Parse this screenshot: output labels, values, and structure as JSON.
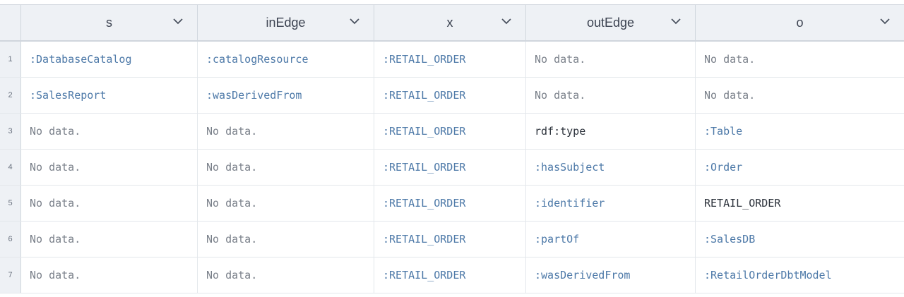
{
  "columns": [
    "s",
    "inEdge",
    "x",
    "outEdge",
    "o"
  ],
  "rows": [
    {
      "num": "1",
      "s": ":DatabaseCatalog",
      "inEdge": ":catalogResource",
      "x": ":RETAIL_ORDER",
      "outEdge": "No data.",
      "o": "No data."
    },
    {
      "num": "2",
      "s": ":SalesReport",
      "inEdge": ":wasDerivedFrom",
      "x": ":RETAIL_ORDER",
      "outEdge": "No data.",
      "o": "No data."
    },
    {
      "num": "3",
      "s": "No data.",
      "inEdge": "No data.",
      "x": ":RETAIL_ORDER",
      "outEdge": "rdf:type",
      "o": ":Table"
    },
    {
      "num": "4",
      "s": "No data.",
      "inEdge": "No data.",
      "x": ":RETAIL_ORDER",
      "outEdge": ":hasSubject",
      "o": ":Order"
    },
    {
      "num": "5",
      "s": "No data.",
      "inEdge": "No data.",
      "x": ":RETAIL_ORDER",
      "outEdge": ":identifier",
      "o": "RETAIL_ORDER"
    },
    {
      "num": "6",
      "s": "No data.",
      "inEdge": "No data.",
      "x": ":RETAIL_ORDER",
      "outEdge": ":partOf",
      "o": ":SalesDB"
    },
    {
      "num": "7",
      "s": "No data.",
      "inEdge": "No data.",
      "x": ":RETAIL_ORDER",
      "outEdge": ":wasDerivedFrom",
      "o": ":RetailOrderDbtModel"
    }
  ],
  "empty_text": "No data.",
  "icons": {
    "column_menu": "chevron-down-icon"
  },
  "colors": {
    "link": "#4d79a8",
    "muted": "#7a808a",
    "plain": "#2c323b",
    "header_bg": "#eef1f5"
  }
}
